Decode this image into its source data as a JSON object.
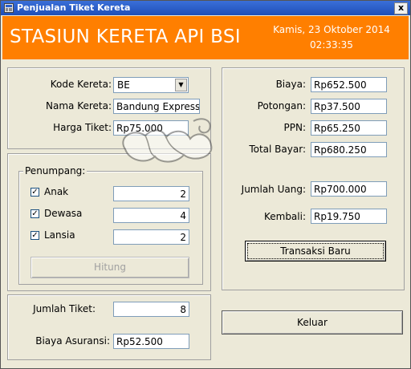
{
  "window": {
    "title": "Penjualan Tiket Kereta",
    "close_label": "x"
  },
  "banner": {
    "station_name": "STASIUN KERETA API BSI",
    "date": "Kamis, 23 Oktober 2014",
    "time": "02:33:35"
  },
  "train": {
    "code_label": "Kode Kereta:",
    "code_value": "BE",
    "name_label": "Nama Kereta:",
    "name_value": "Bandung Express",
    "price_label": "Harga Tiket:",
    "price_value": "Rp75.000"
  },
  "passengers": {
    "group_label": "Penumpang:",
    "items": [
      {
        "label": "Anak",
        "checked": true,
        "count": "2"
      },
      {
        "label": "Dewasa",
        "checked": true,
        "count": "4"
      },
      {
        "label": "Lansia",
        "checked": true,
        "count": "2"
      }
    ],
    "compute_label": "Hitung"
  },
  "totals_left": {
    "tickets_label": "Jumlah Tiket:",
    "tickets_value": "8",
    "insurance_label": "Biaya Asuransi:",
    "insurance_value": "Rp52.500"
  },
  "payment": {
    "cost_label": "Biaya:",
    "cost_value": "Rp652.500",
    "discount_label": "Potongan:",
    "discount_value": "Rp37.500",
    "tax_label": "PPN:",
    "tax_value": "Rp65.250",
    "total_label": "Total Bayar:",
    "total_value": "Rp680.250",
    "paid_label": "Jumlah Uang:",
    "paid_value": "Rp700.000",
    "change_label": "Kembali:",
    "change_value": "Rp19.750",
    "new_transaction_label": "Transaksi Baru"
  },
  "exit_label": "Keluar",
  "colors": {
    "banner": "#ff7f00",
    "titlebar": "#2a5fcc",
    "window_bg": "#ece9d8"
  },
  "icons": {
    "app": "app-icon",
    "close": "close-icon",
    "dropdown": "chevron-down-icon",
    "checkbox": "check-icon",
    "watermark": "watermark-logo"
  }
}
